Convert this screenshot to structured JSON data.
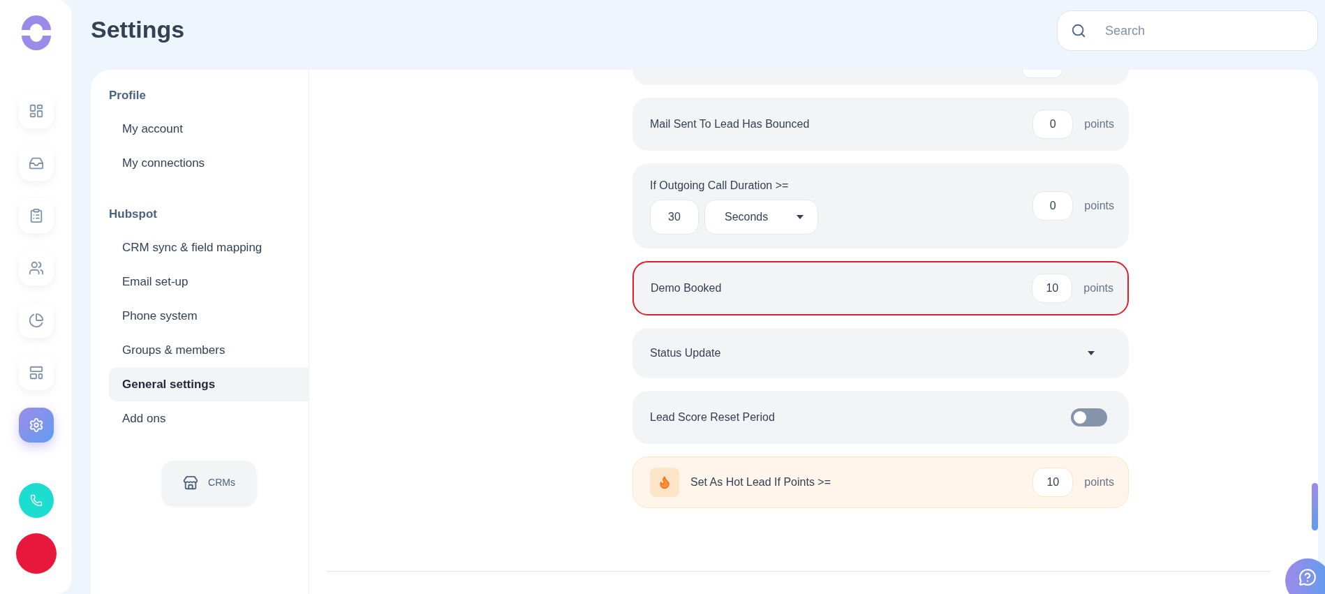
{
  "rail": {
    "items": [
      {
        "kind": "dashboard",
        "selected": false
      },
      {
        "kind": "inbox",
        "selected": false
      },
      {
        "kind": "tasks",
        "selected": false
      },
      {
        "kind": "team",
        "selected": false
      },
      {
        "kind": "reports",
        "selected": false
      },
      {
        "kind": "layout",
        "selected": false
      },
      {
        "kind": "settings",
        "selected": true
      }
    ]
  },
  "header": {
    "title": "Settings",
    "search": {
      "placeholder": "Search"
    }
  },
  "sidebar": {
    "sections": [
      {
        "heading": "Profile",
        "items": [
          {
            "label": "My account",
            "selected": false
          },
          {
            "label": "My connections",
            "selected": false
          }
        ]
      },
      {
        "heading": "Hubspot",
        "items": [
          {
            "label": "CRM sync & field mapping",
            "selected": false
          },
          {
            "label": "Email set-up",
            "selected": false
          },
          {
            "label": "Phone system",
            "selected": false
          },
          {
            "label": "Groups & members",
            "selected": false
          },
          {
            "label": "General settings",
            "selected": true
          },
          {
            "label": "Add ons",
            "selected": false
          }
        ]
      }
    ],
    "crm_button": {
      "label": "CRMs"
    }
  },
  "rules": [
    {
      "kind": "points",
      "label": "Mail Sent To Lead Has Bounced",
      "value": "0",
      "unit": "points",
      "highlighted": false
    },
    {
      "kind": "duration",
      "label": "If Outgoing Call Duration >=",
      "duration": "30",
      "duration_unit": "Seconds",
      "value": "0",
      "unit": "points",
      "highlighted": false
    },
    {
      "kind": "points",
      "label": "Demo Booked",
      "value": "10",
      "unit": "points",
      "highlighted": true
    },
    {
      "kind": "select",
      "label": "Status Update",
      "highlighted": false
    },
    {
      "kind": "toggle",
      "label": "Lead Score Reset Period",
      "on": false,
      "highlighted": false
    },
    {
      "kind": "hot",
      "label": "Set As Hot Lead If Points >=",
      "value": "10",
      "unit": "points",
      "highlighted": false
    }
  ]
}
